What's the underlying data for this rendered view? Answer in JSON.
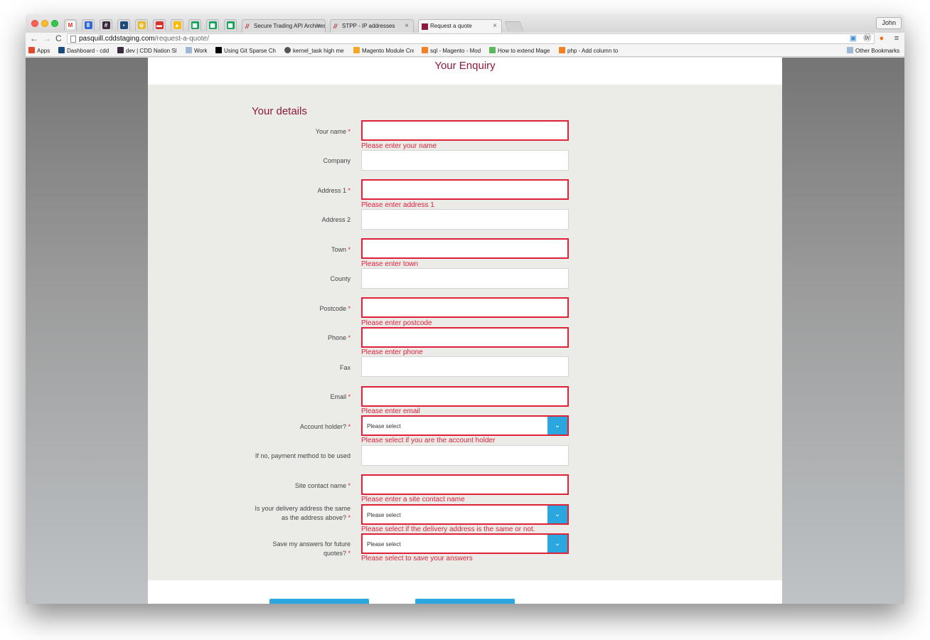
{
  "browser": {
    "tabs": [
      {
        "title": "Secure Trading API Archives"
      },
      {
        "title": "STPP - IP addresses"
      },
      {
        "title": "Request a quote"
      }
    ],
    "profile_name": "John",
    "url_host": "pasquill.cddstaging.com",
    "url_path": "/request-a-quote/",
    "bookmarks": [
      "Apps",
      "Dashboard - cdd",
      "dev | CDD Nation Sl",
      "Work",
      "Using Git Sparse Ch",
      "kernel_task high me",
      "Magento Module Cre",
      "sql - Magento - Mod",
      "How to extend Mage",
      "php - Add column to"
    ],
    "other_bookmarks": "Other Bookmarks"
  },
  "page": {
    "header_title": "Your Enquiry",
    "section_title": "Your details",
    "required_mark": "*",
    "fields": {
      "name": {
        "label": "Your name",
        "error": "Please enter your name"
      },
      "company": {
        "label": "Company"
      },
      "address1": {
        "label": "Address 1",
        "error": "Please enter address 1"
      },
      "address2": {
        "label": "Address 2"
      },
      "town": {
        "label": "Town",
        "error": "Please enter town"
      },
      "county": {
        "label": "County"
      },
      "postcode": {
        "label": "Postcode",
        "error": "Please enter postcode"
      },
      "phone": {
        "label": "Phone",
        "error": "Please enter phone"
      },
      "fax": {
        "label": "Fax"
      },
      "email": {
        "label": "Email",
        "error": "Please enter email"
      },
      "account_holder": {
        "label": "Account holder?",
        "value": "Please select",
        "error": "Please select if you are the account holder"
      },
      "payment_method": {
        "label": "If no, payment method to be used"
      },
      "site_contact": {
        "label": "Site contact name",
        "error": "Please enter a site contact name"
      },
      "delivery_same": {
        "label_line1": "Is your delivery address the same",
        "label_line2": "as the address above?",
        "value": "Please select",
        "error": "Please select if the delivery address is the same or not."
      },
      "save_answers": {
        "label_line1": "Save my answers for future",
        "label_line2": "quotes?",
        "value": "Please select",
        "error": "Please select to save your answers"
      }
    }
  },
  "colors": {
    "accent": "#2ba7e0",
    "error": "#e0213a",
    "brand": "#8b1a3c"
  }
}
